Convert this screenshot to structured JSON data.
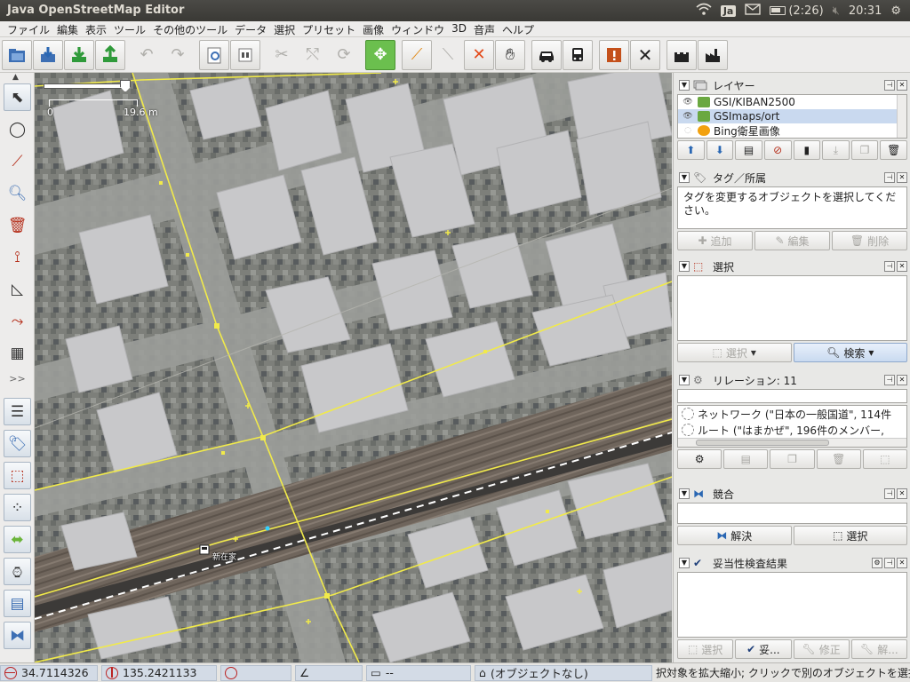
{
  "window": {
    "title": "Java OpenStreetMap Editor"
  },
  "tray": {
    "input_method": "Ja",
    "battery": "(2:26)",
    "clock": "20:31"
  },
  "menu": [
    "ファイル",
    "編集",
    "表示",
    "ツール",
    "その他のツール",
    "データ",
    "選択",
    "プリセット",
    "画像",
    "ウィンドウ",
    "3D",
    "音声",
    "ヘルプ"
  ],
  "map": {
    "scale_zero": "0",
    "scale_length": "19.6 m",
    "station_label": "新在家"
  },
  "panels": {
    "layers": {
      "title": "レイヤー",
      "items": [
        {
          "name": "GSI/KIBAN2500",
          "visible": true,
          "selected": false
        },
        {
          "name": "GSImaps/ort",
          "visible": true,
          "selected": true
        },
        {
          "name": "Bing衛星画像",
          "visible": false,
          "selected": false
        }
      ]
    },
    "tags": {
      "title": "タグ／所属",
      "message": "タグを変更するオブジェクトを選択してください。",
      "add": "追加",
      "edit": "編集",
      "delete": "削除"
    },
    "selection": {
      "title": "選択",
      "select": "選択",
      "search": "検索"
    },
    "relations": {
      "title": "リレーション: 11",
      "items": [
        "ネットワーク (\"日本の一般国道\", 114件",
        "ルート (\"はまかぜ\", 196件のメンバー,"
      ]
    },
    "conflict": {
      "title": "競合",
      "resolve": "解決",
      "select": "選択"
    },
    "validation": {
      "title": "妥当性検査結果",
      "select": "選択",
      "ignore": "妥...",
      "fix": "修正",
      "ignore2": "解..."
    }
  },
  "status": {
    "lat": "34.7114326",
    "lon": "135.2421133",
    "heading": "",
    "angle": "",
    "distance": "--",
    "object": "(オブジェクトなし)",
    "help": "択対象を拡大縮小; クリックで別のオブジェクトを選択"
  }
}
